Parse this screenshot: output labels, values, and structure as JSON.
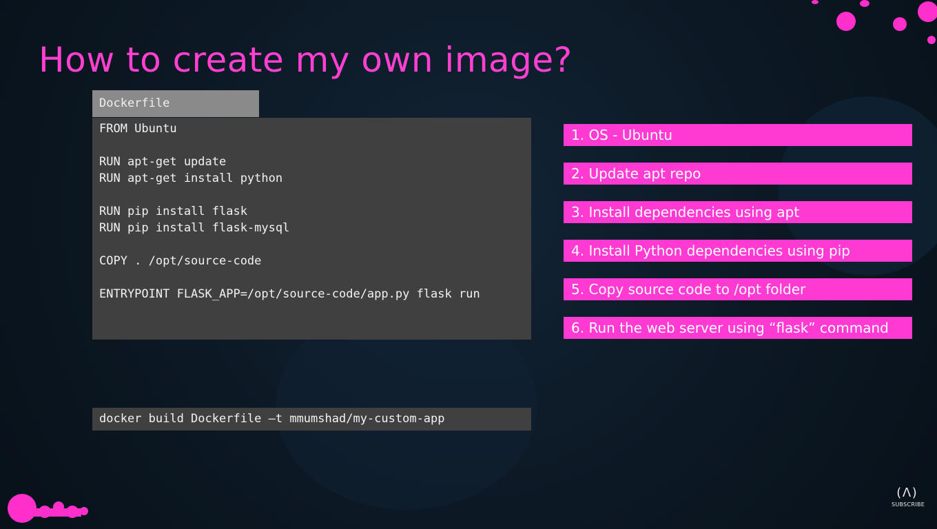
{
  "slide": {
    "title": "How to create my own image?"
  },
  "dockerfile": {
    "tab_label": "Dockerfile",
    "lines": [
      "FROM Ubuntu",
      "",
      "RUN apt-get update",
      "RUN apt-get install python",
      "",
      "RUN pip install flask",
      "RUN pip install flask-mysql",
      "",
      "COPY . /opt/source-code",
      "",
      "ENTRYPOINT FLASK_APP=/opt/source-code/app.py flask run"
    ]
  },
  "command": {
    "text": "docker build Dockerfile –t mmumshad/my-custom-app"
  },
  "steps": [
    "1. OS - Ubuntu",
    "2. Update apt repo",
    "3. Install dependencies using apt",
    "4. Install Python dependencies using pip",
    "5. Copy source code to /opt folder",
    "6. Run the web server using “flask” command"
  ],
  "overlay": {
    "logo_mark": "(ᐱ)",
    "subscribe_label": "SUBSCRIBE"
  },
  "colors": {
    "accent": "#ff3ad3",
    "background": "#0d1a26",
    "code_bg": "#404040",
    "tab_bg": "#8a8a8a"
  }
}
